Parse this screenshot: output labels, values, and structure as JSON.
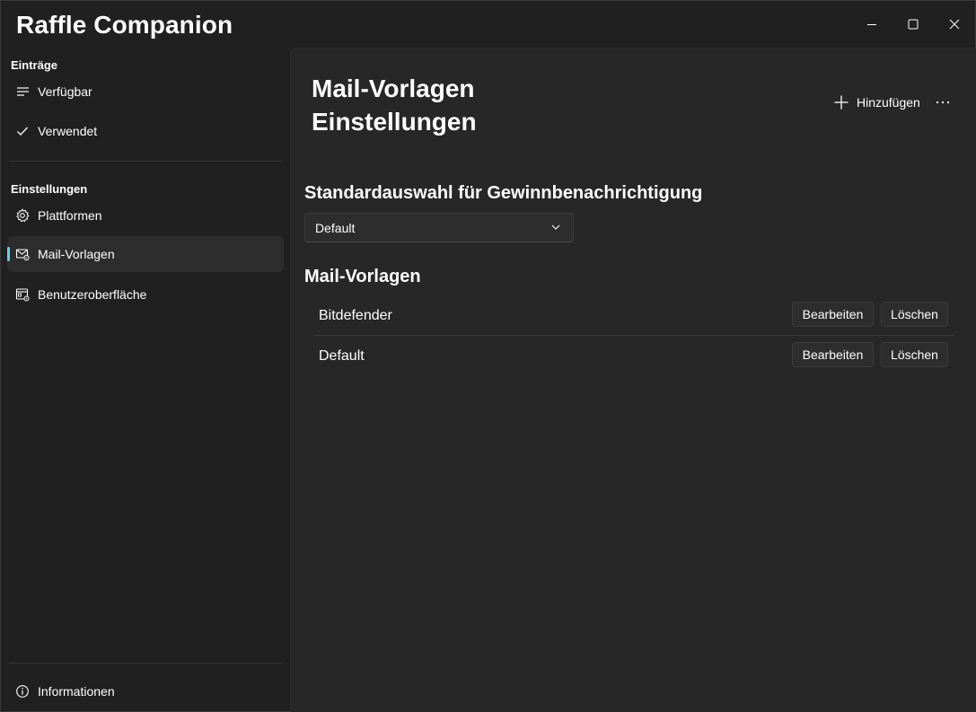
{
  "app": {
    "title": "Raffle Companion"
  },
  "sidebar": {
    "sections": [
      {
        "header": "Einträge"
      },
      {
        "header": "Einstellungen"
      }
    ],
    "items": [
      {
        "label": "Verfügbar",
        "icon": "list-icon"
      },
      {
        "label": "Verwendet",
        "icon": "checkmark-icon"
      },
      {
        "label": "Plattformen",
        "icon": "gear-icon"
      },
      {
        "label": "Mail-Vorlagen",
        "icon": "mail-settings-icon",
        "selected": true
      },
      {
        "label": "Benutzeroberfläche",
        "icon": "window-settings-icon"
      }
    ],
    "footer": {
      "label": "Informationen",
      "icon": "info-icon"
    }
  },
  "main": {
    "title": "Mail-Vorlagen Einstellungen",
    "commands": {
      "add_label": "Hinzufügen",
      "more_icon": "more-icon"
    },
    "default_selection": {
      "title": "Standardauswahl für Gewinnbenachrichtigung",
      "value": "Default"
    },
    "templates": {
      "title": "Mail-Vorlagen",
      "rows": [
        {
          "name": "Bitdefender",
          "edit_label": "Bearbeiten",
          "delete_label": "Löschen"
        },
        {
          "name": "Default",
          "edit_label": "Bearbeiten",
          "delete_label": "Löschen"
        }
      ]
    }
  },
  "colors": {
    "accent": "#60cdff",
    "window_bg": "#202020",
    "content_bg": "#272727",
    "control_bg": "#2d2d2d"
  }
}
